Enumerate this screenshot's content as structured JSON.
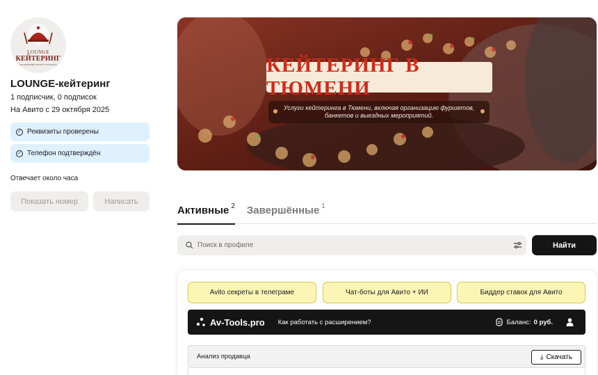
{
  "profile": {
    "logo": {
      "line1": "LOUNGE",
      "line2": "КЕЙТЕРИНГ",
      "line3": "ПРАЗДНИЧНЫЙ ФУРШЕТ И БАНКЕТЫ"
    },
    "name": "LOUNGE-кейтеринг",
    "subscribers": "1 подписчик, 0 подписок",
    "since": "На Авито с 29 октября 2025",
    "badges": [
      "Реквизиты проверены",
      "Телефон подтверждён"
    ],
    "reply_time": "Отвечает около часа",
    "show_number_label": "Показать номер",
    "write_label": "Написать"
  },
  "banner": {
    "title": "КЕЙТЕРИНГ В ТЮМЕНИ",
    "subtitle_line1": "Услуги кейтеринга в Тюмени, включая организацию фуршетов,",
    "subtitle_line2": "банкетов и выездных мероприятий."
  },
  "tabs": [
    {
      "label": "Активные",
      "count": "2"
    },
    {
      "label": "Завершённые",
      "count": "1"
    }
  ],
  "search": {
    "placeholder": "Поиск в профиле",
    "button_label": "Найти"
  },
  "extension": {
    "promos": [
      "Avito секреты в телеграме",
      "Чат-боты для Авито + ИИ",
      "Биддер ставок для Авито"
    ],
    "brand": "Av-Tools.pro",
    "help_link": "Как работать с расширением?",
    "balance_label": "Баланс:",
    "balance_value": "0 руб.",
    "analysis_label": "Анализ продавца",
    "download_label": "Скачать"
  },
  "colors": {
    "verify_bg": "#dff1fd",
    "promo_bg": "#fcf6b6",
    "dark": "#151515",
    "banner_title_red": "#d12a1a"
  }
}
